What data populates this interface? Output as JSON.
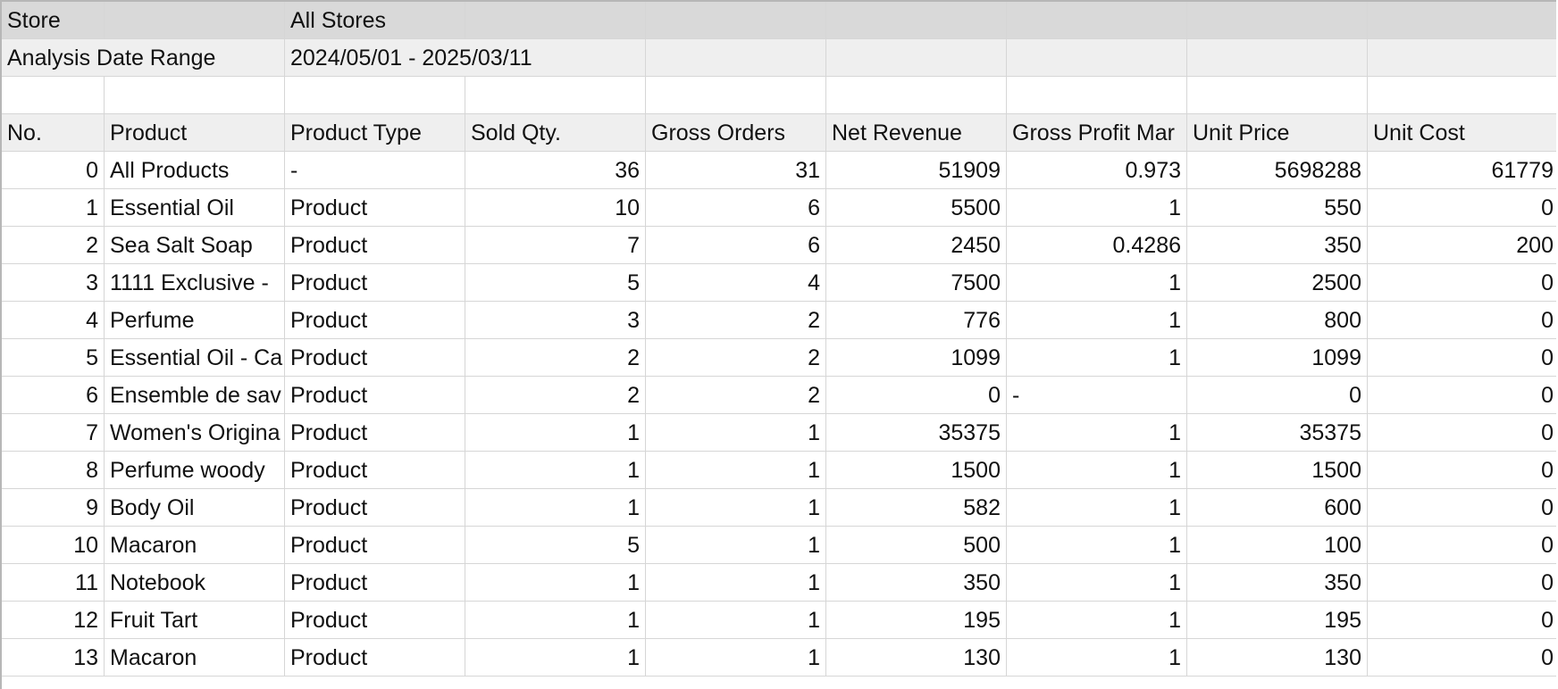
{
  "meta": {
    "store_label": "Store",
    "store_value": "All Stores",
    "date_range_label": "Analysis Date Range",
    "date_range_value": "2024/05/01 - 2025/03/11"
  },
  "table": {
    "headers": [
      "No.",
      "Product",
      "Product Type",
      "Sold Qty.",
      "Gross Orders",
      "Net Revenue",
      "Gross Profit Mar",
      "Unit Price",
      "Unit Cost"
    ],
    "rows": [
      [
        "0",
        "All Products",
        "-",
        "36",
        "31",
        "51909",
        "0.973",
        "5698288",
        "61779"
      ],
      [
        "1",
        "Essential Oil",
        "Product",
        "10",
        "6",
        "5500",
        "1",
        "550",
        "0"
      ],
      [
        "2",
        "Sea Salt Soap",
        "Product",
        "7",
        "6",
        "2450",
        "0.4286",
        "350",
        "200"
      ],
      [
        "3",
        "1111 Exclusive -",
        "Product",
        "5",
        "4",
        "7500",
        "1",
        "2500",
        "0"
      ],
      [
        "4",
        "Perfume",
        "Product",
        "3",
        "2",
        "776",
        "1",
        "800",
        "0"
      ],
      [
        "5",
        "Essential Oil - Ca",
        "Product",
        "2",
        "2",
        "1099",
        "1",
        "1099",
        "0"
      ],
      [
        "6",
        "Ensemble de sav",
        "Product",
        "2",
        "2",
        "0",
        "-",
        "0",
        "0"
      ],
      [
        "7",
        "Women's Origina",
        "Product",
        "1",
        "1",
        "35375",
        "1",
        "35375",
        "0"
      ],
      [
        "8",
        "Perfume woody",
        "Product",
        "1",
        "1",
        "1500",
        "1",
        "1500",
        "0"
      ],
      [
        "9",
        "Body Oil",
        "Product",
        "1",
        "1",
        "582",
        "1",
        "600",
        "0"
      ],
      [
        "10",
        "Macaron",
        "Product",
        "5",
        "1",
        "500",
        "1",
        "100",
        "0"
      ],
      [
        "11",
        "Notebook",
        "Product",
        "1",
        "1",
        "350",
        "1",
        "350",
        "0"
      ],
      [
        "12",
        "Fruit Tart",
        "Product",
        "1",
        "1",
        "195",
        "1",
        "195",
        "0"
      ],
      [
        "13",
        "Macaron",
        "Product",
        "1",
        "1",
        "130",
        "1",
        "130",
        "0"
      ]
    ]
  }
}
